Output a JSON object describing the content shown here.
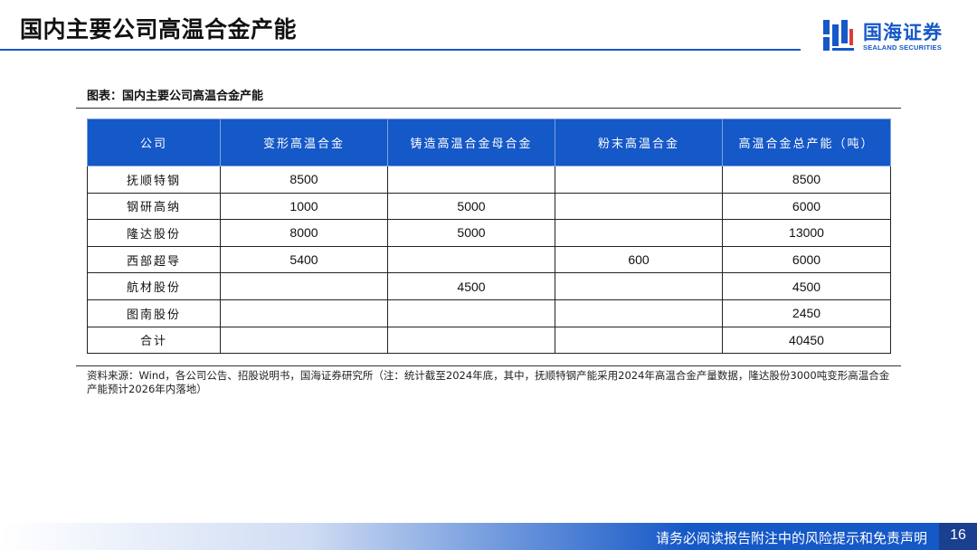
{
  "header": {
    "title": "国内主要公司高温合金产能",
    "brand_cn": "国海证券",
    "brand_en": "SEALAND SECURITIES",
    "brand_color": "#1558c7"
  },
  "figure": {
    "caption": "图表：国内主要公司高温合金产能",
    "columns": [
      "公司",
      "变形高温合金",
      "铸造高温合金母合金",
      "粉末高温合金",
      "高温合金总产能（吨）"
    ],
    "rows": [
      [
        "抚顺特钢",
        "8500",
        "",
        "",
        "8500"
      ],
      [
        "钢研高纳",
        "1000",
        "5000",
        "",
        "6000"
      ],
      [
        "隆达股份",
        "8000",
        "5000",
        "",
        "13000"
      ],
      [
        "西部超导",
        "5400",
        "",
        "600",
        "6000"
      ],
      [
        "航材股份",
        "",
        "4500",
        "",
        "4500"
      ],
      [
        "图南股份",
        "",
        "",
        "",
        "2450"
      ],
      [
        "合计",
        "",
        "",
        "",
        "40450"
      ]
    ],
    "source": "资料来源：Wind，各公司公告、招股说明书，国海证券研究所（注：统计截至2024年底，其中，抚顺特钢产能采用2024年高温合金产量数据，隆达股份3000吨变形高温合金产能预计2026年内落地）"
  },
  "footer": {
    "disclaimer": "请务必阅读报告附注中的风险提示和免责声明",
    "page": "16"
  }
}
